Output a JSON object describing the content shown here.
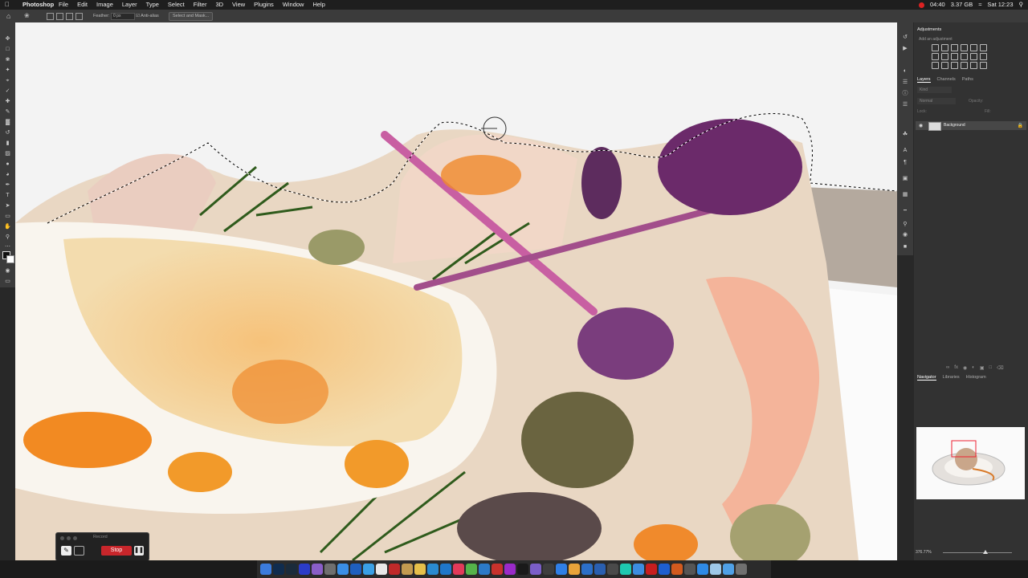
{
  "menubar": {
    "apple": "",
    "app_name": "Photoshop",
    "menus": [
      "File",
      "Edit",
      "Image",
      "Layer",
      "Type",
      "Select",
      "Filter",
      "3D",
      "View",
      "Plugins",
      "Window",
      "Help"
    ],
    "status": {
      "timer": "04:40",
      "memory": "3.37 GB",
      "datetime": "Sat 12:23"
    }
  },
  "options_bar": {
    "feather_label": "Feather:",
    "feather_value": "0 px",
    "anti_alias_label": "Anti-alias",
    "select_and_mask_label": "Select and Mask..."
  },
  "panels": {
    "adjustments_title": "Adjustments",
    "adjustments_sub": "Add an adjustment",
    "layers_tabs": [
      "Layers",
      "Channels",
      "Paths"
    ],
    "kind_placeholder": "Kind",
    "blend_mode": "Normal",
    "opacity_label": "Opacity:",
    "lock_label": "Lock:",
    "fill_label": "Fill:",
    "layer_name": "Background",
    "navigator_tabs": [
      "Navigator",
      "Libraries",
      "Histogram"
    ],
    "zoom_level": "376.77%"
  },
  "record_widget": {
    "title": "Record",
    "stop_label": "Stop"
  },
  "colors": {
    "foreground": "#111111",
    "background": "#ffffff",
    "stop_red": "#c8262b"
  }
}
